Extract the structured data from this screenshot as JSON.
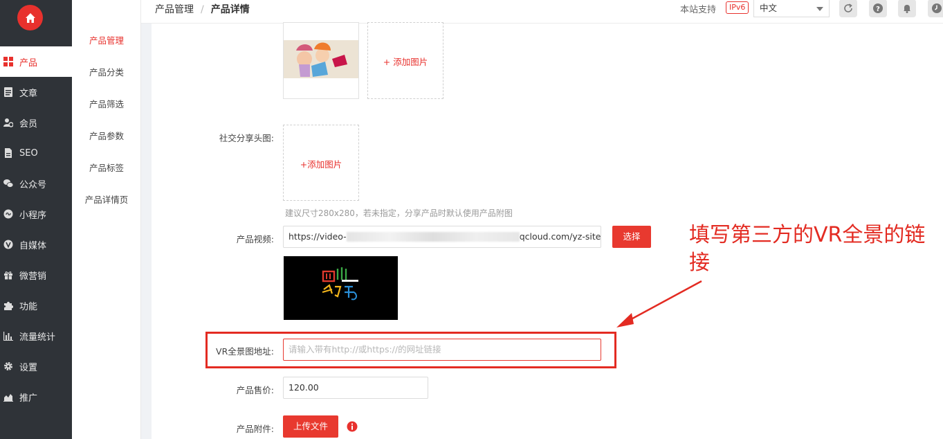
{
  "nav": {
    "items": [
      {
        "label": "产品",
        "icon": "grid-icon",
        "active": true
      },
      {
        "label": "文章",
        "icon": "document-icon",
        "active": false
      },
      {
        "label": "会员",
        "icon": "user-icon",
        "active": false
      },
      {
        "label": "SEO",
        "icon": "file-icon",
        "active": false
      },
      {
        "label": "公众号",
        "icon": "wechat-icon",
        "active": false
      },
      {
        "label": "小程序",
        "icon": "mini-program-icon",
        "active": false
      },
      {
        "label": "自媒体",
        "icon": "v-icon",
        "active": false
      },
      {
        "label": "微营销",
        "icon": "gift-icon",
        "active": false
      },
      {
        "label": "功能",
        "icon": "puzzle-icon",
        "active": false
      },
      {
        "label": "流量统计",
        "icon": "bar-chart-icon",
        "active": false
      },
      {
        "label": "设置",
        "icon": "gear-icon",
        "active": false
      },
      {
        "label": "推广",
        "icon": "area-chart-icon",
        "active": false
      }
    ]
  },
  "subnav": {
    "items": [
      {
        "label": "产品管理",
        "active": true
      },
      {
        "label": "产品分类",
        "active": false
      },
      {
        "label": "产品筛选",
        "active": false
      },
      {
        "label": "产品参数",
        "active": false
      },
      {
        "label": "产品标签",
        "active": false
      },
      {
        "label": "产品详情页",
        "active": false
      }
    ]
  },
  "topbar": {
    "breadcrumb": [
      "产品管理",
      "产品详情"
    ],
    "support_text": "本站支持",
    "ipv6_badge": "IPv6",
    "language": "中文",
    "icons": [
      "refresh-icon",
      "help-icon",
      "bell-icon",
      "clock-icon"
    ]
  },
  "form": {
    "gallery_add": "+ 添加图片",
    "social_label": "社交分享头图:",
    "social_add": "+添加图片",
    "social_hint": "建议尺寸280x280，若未指定，分享产品时默认使用产品附图",
    "video_label": "产品视频:",
    "video_url_prefix": "https://video-",
    "video_url_suffix": "qcloud.com/yz-site-demo.mp",
    "video_select": "选择",
    "vr_label": "VR全景图地址:",
    "vr_placeholder": "请输入带有http://或https://的网址链接",
    "price_label": "产品售价:",
    "price_value": "120.00",
    "attach_label": "产品附件:",
    "attach_button": "上传文件"
  },
  "annotation": {
    "text": "填写第三方的VR全景的链接",
    "color": "#e32b22"
  },
  "colors": {
    "accent": "#e8312d",
    "sidebar_bg": "#2f3338"
  }
}
